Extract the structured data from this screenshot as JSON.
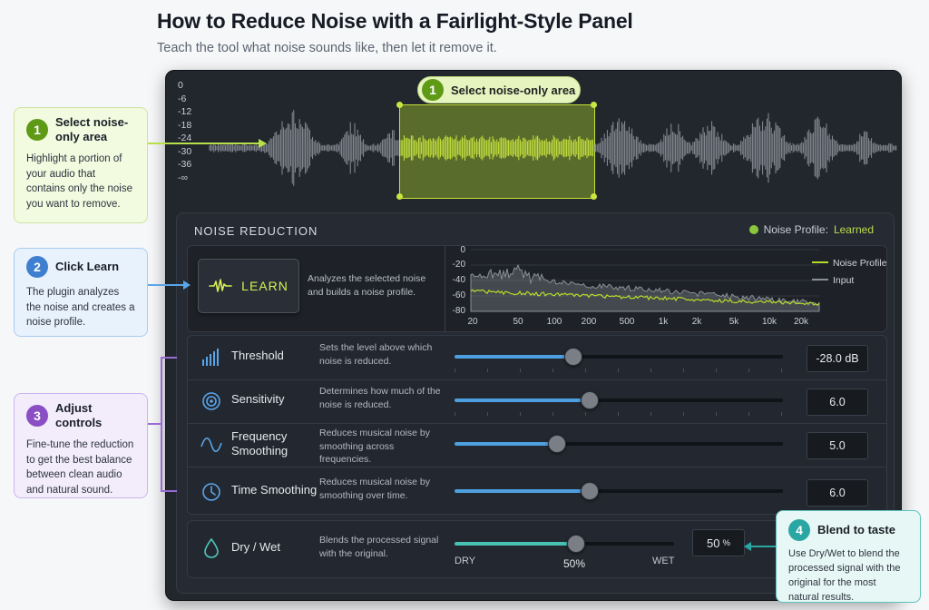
{
  "header": {
    "title": "How to Reduce Noise with a Fairlight-Style Panel",
    "subtitle": "Teach the tool what noise sounds like, then let it remove it."
  },
  "waveform": {
    "db_scale": [
      "0",
      "-6",
      "-12",
      "-18",
      "-24",
      "-30",
      "-36",
      "-∞"
    ],
    "selection_badge": "1",
    "selection_label": "Select noise-only area"
  },
  "noise_reduction": {
    "title": "NOISE REDUCTION",
    "profile_label": "Noise Profile:",
    "profile_status": "Learned",
    "learn": {
      "button_label": "LEARN",
      "description": "Analyzes the selected noise and builds a noise profile."
    },
    "spectrum": {
      "y_ticks": [
        "0",
        "-20",
        "-40",
        "-60",
        "-80"
      ],
      "x_ticks": [
        "20",
        "50",
        "100",
        "200",
        "500",
        "1k",
        "2k",
        "5k",
        "10k",
        "20k"
      ],
      "legend": [
        "Noise Profile",
        "Input"
      ]
    },
    "controls": [
      {
        "name": "Threshold",
        "description": "Sets the level above which noise is reduced.",
        "value": "-28.0 dB",
        "level": 0.36
      },
      {
        "name": "Sensitivity",
        "description": "Determines how much of the noise is reduced.",
        "value": "6.0",
        "level": 0.41
      },
      {
        "name": "Frequency Smoothing",
        "description": "Reduces musical noise by smoothing across frequencies.",
        "value": "5.0",
        "level": 0.31
      },
      {
        "name": "Time Smoothing",
        "description": "Reduces musical noise by smoothing over time.",
        "value": "6.0",
        "level": 0.41
      }
    ],
    "dry_wet": {
      "name": "Dry / Wet",
      "description": "Blends the processed signal with the original.",
      "value": "50",
      "unit": "%",
      "level": 0.55,
      "left_label": "DRY",
      "center_label": "50%",
      "right_label": "WET"
    }
  },
  "callouts": [
    {
      "num": "1",
      "title": "Select noise-only area",
      "body": "Highlight a portion of your audio that contains only the noise you want to remove."
    },
    {
      "num": "2",
      "title": "Click Learn",
      "body": "The plugin analyzes the noise and creates a noise profile."
    },
    {
      "num": "3",
      "title": "Adjust controls",
      "body": "Fine-tune the reduction to get the best balance between clean audio and natural sound."
    },
    {
      "num": "4",
      "title": "Blend to taste",
      "body": "Use Dry/Wet to blend the processed signal with the original for the most natural results."
    }
  ],
  "colors": {
    "selection": "#c5e23a",
    "slider_fill": "#4e9fe0",
    "dry_wet_fill": "#47c2b3",
    "profile_line": "#b5dc2b",
    "input_line": "#8a8f97"
  }
}
